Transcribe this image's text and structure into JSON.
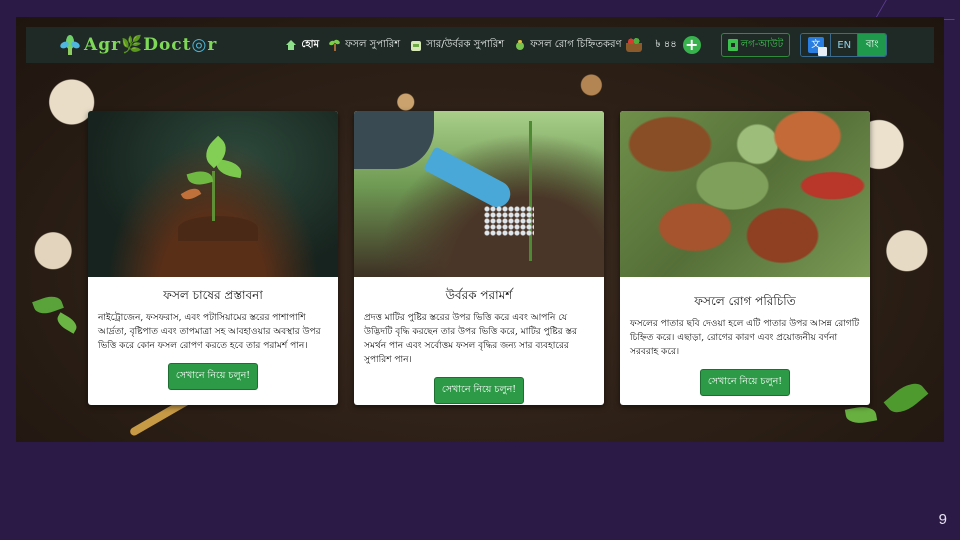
{
  "slide_number": "9",
  "brand": {
    "part1": "Agr",
    "part2": "Doct",
    "part3": "r"
  },
  "nav": {
    "items": [
      {
        "label": "হোম",
        "icon": "home-icon"
      },
      {
        "label": "ফসল সুপারিশ",
        "icon": "sprout-icon"
      },
      {
        "label": "সার/উর্বরক সুপারিশ",
        "icon": "fertilizer-bag-icon"
      },
      {
        "label": "ফসল রোগ চিহ্নিতকরণ",
        "icon": "plant-disease-icon"
      }
    ],
    "balance": "৳ ৪৪",
    "add_label": "+",
    "logout_label": "লগ-আউট",
    "translate_label": "文",
    "lang_en": "EN",
    "lang_bn": "বাং"
  },
  "cards": [
    {
      "title": "ফসল চাষের প্রস্তাবনা",
      "text": "নাইট্রোজেন, ফসফরাস, এবং পটাসিয়ামের স্তরের পাশাপাশি আর্দ্রতা, বৃষ্টিপাত এবং তাপমাত্রা সহ আবহাওয়ার অবস্থার উপর ভিত্তি করে কোন ফসল রোপণ করতে হবে তার পরামর্শ পান।",
      "button": "সেখানে নিয়ে চলুন!"
    },
    {
      "title": "উর্বরক পরামর্শ",
      "text": "প্রদত্ত মাটির পুষ্টির স্তরের উপর ভিত্তি করে এবং আপনি যে উদ্ভিদটি বৃদ্ধি করছেন তার উপর ভিত্তি করে, মাটির পুষ্টির স্তর সমর্থন পান এবং সর্বোত্তম ফসল বৃদ্ধির জন্য সার ব্যবহারের সুপারিশ পান।",
      "button": "সেখানে নিয়ে চলুন!"
    },
    {
      "title": "ফসলে রোগ পরিচিতি",
      "text": "ফসলের পাতার ছবি দেওয়া হলে এটি পাতার উপর আসন্ন রোগটি চিহ্নিত করে। এছাড়া, রোগের কারণ এবং প্রয়োজনীয় বর্ণনা সরবরাহ করে।",
      "button": "সেখানে নিয়ে চলুন!"
    }
  ]
}
